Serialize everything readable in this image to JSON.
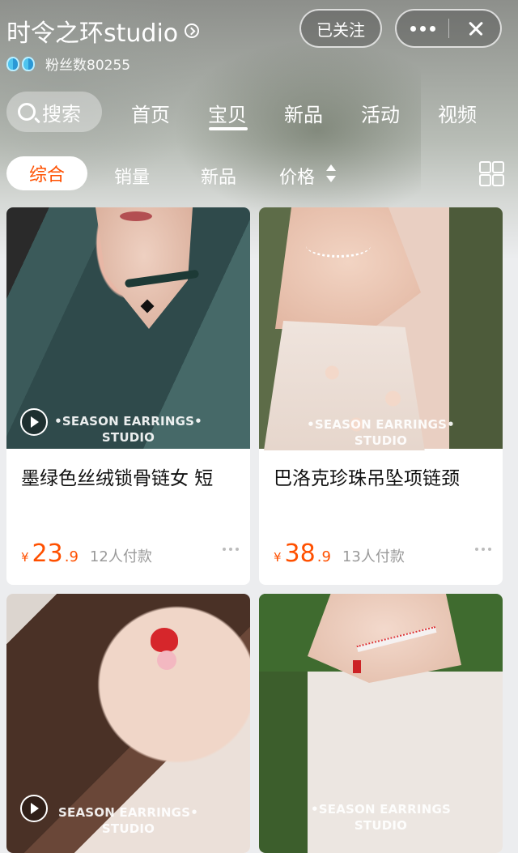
{
  "header": {
    "shop_name": "时令之环studio",
    "fans_label": "粉丝数80255",
    "follow_label": "已关注"
  },
  "nav": {
    "search_label": "搜索",
    "tabs": [
      {
        "label": "首页"
      },
      {
        "label": "宝贝"
      },
      {
        "label": "新品"
      },
      {
        "label": "活动"
      },
      {
        "label": "视频"
      }
    ],
    "active_tab": "宝贝"
  },
  "filters": {
    "items": [
      {
        "label": "综合"
      },
      {
        "label": "销量"
      },
      {
        "label": "新品"
      },
      {
        "label": "价格"
      }
    ],
    "active": "综合"
  },
  "products": [
    {
      "title": "墨绿色丝绒锁骨链女 短",
      "watermark_line1": "•SEASON EARRINGS•",
      "watermark_line2": "STUDIO",
      "currency": "¥",
      "price_int": "23",
      "price_dec": ".9",
      "paid": "12人付款",
      "has_video": true
    },
    {
      "title": "巴洛克珍珠吊坠项链颈",
      "watermark_line1": "•SEASON EARRINGS•",
      "watermark_line2": "STUDIO",
      "currency": "¥",
      "price_int": "38",
      "price_dec": ".9",
      "paid": "13人付款",
      "has_video": false
    },
    {
      "title": "",
      "watermark_line1": "SEASON EARRINGS•",
      "watermark_line2": "STUDIO",
      "has_video": true
    },
    {
      "title": "",
      "watermark_line1": "•SEASON EARRINGS",
      "watermark_line2": "STUDIO",
      "has_video": false
    }
  ],
  "colors": {
    "accent": "#ff5000",
    "muted_text": "#999999",
    "page_bg": "#ecedef"
  }
}
